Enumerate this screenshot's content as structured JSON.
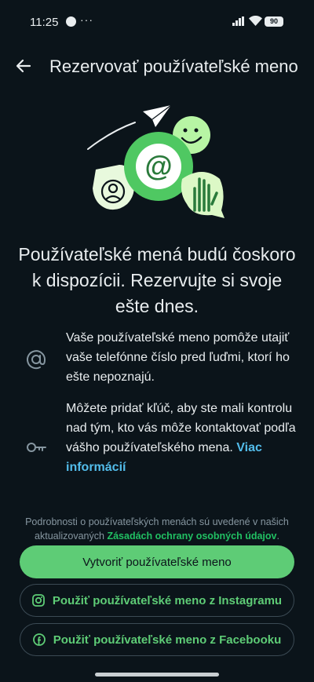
{
  "status_bar": {
    "time": "11:25",
    "extra": "···",
    "battery": "90"
  },
  "app_bar": {
    "title": "Rezervovať používateľské meno"
  },
  "headline": "Používateľské mená budú čoskoro k dispozícii. Rezervujte si svoje ešte dnes.",
  "info": {
    "item1_text": "Vaše používateľské meno pomôže utajiť vaše telefónne číslo pred ľuďmi, ktorí ho ešte nepoznajú.",
    "item2_text": "Môžete pridať kľúč, aby ste mali kontrolu nad tým, kto vás môže kontaktovať podľa vášho používateľského mena.",
    "item2_link": "Viac informácií"
  },
  "footer": {
    "note_text": "Podrobnosti o používateľských menách sú uvedené v našich aktualizovaných",
    "note_link": "Zásadách ochrany osobných údajov",
    "note_end": "."
  },
  "buttons": {
    "create": "Vytvoriť používateľské meno",
    "instagram": "Použiť používateľské meno z Instagramu",
    "facebook": "Použiť používateľské meno z Facebooku"
  },
  "icons": {
    "back": "arrow-left-icon",
    "at": "at-sign-icon",
    "key": "key-icon",
    "instagram": "instagram-icon",
    "facebook": "facebook-icon"
  },
  "colors": {
    "background": "#0b141a",
    "accent_green": "#5ecc76",
    "link_blue": "#53bdeb",
    "text_secondary": "#8696a0"
  }
}
